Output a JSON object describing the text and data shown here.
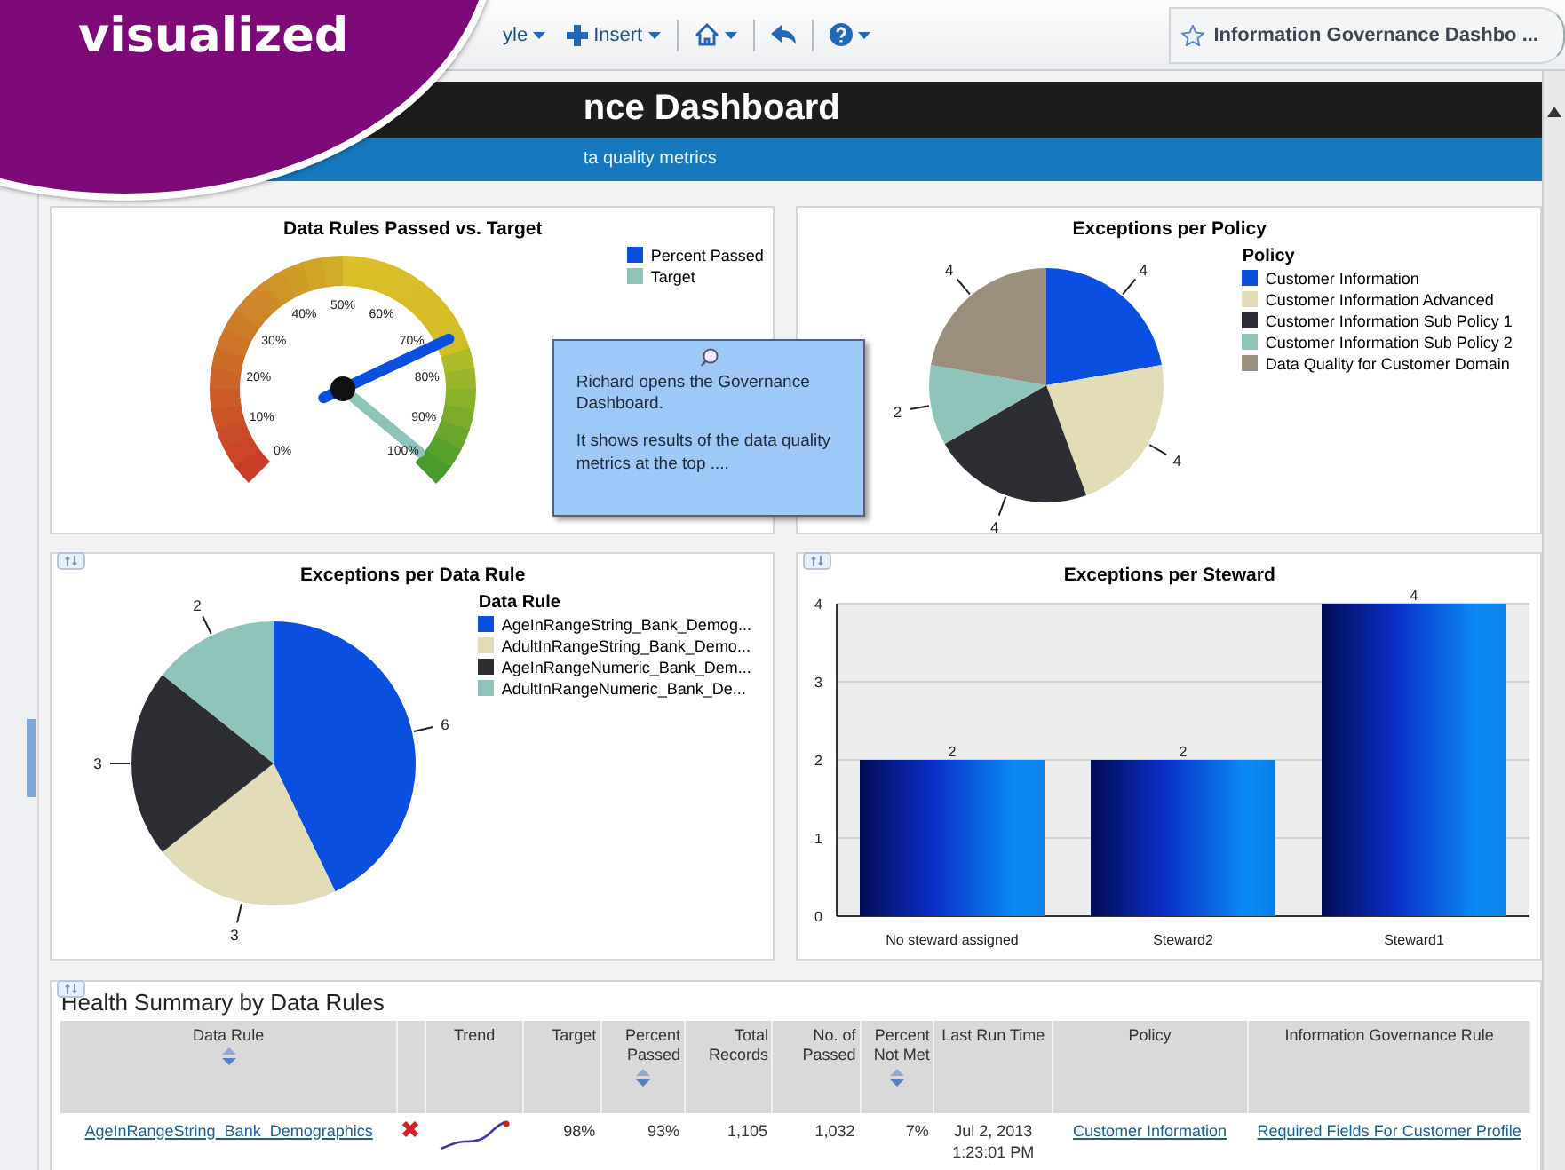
{
  "overlay_label": "visualized",
  "toolbar": {
    "items": [
      {
        "kind": "menu",
        "label": "yle"
      },
      {
        "kind": "insert",
        "label": "Insert"
      },
      {
        "kind": "home"
      },
      {
        "kind": "back"
      },
      {
        "kind": "help"
      }
    ],
    "tab_title": "Information Governance Dashbo ..."
  },
  "dashboard": {
    "title": "nce Dashboard",
    "subtitle": "ta quality metrics"
  },
  "gauge_panel": {
    "title": "Data Rules Passed vs. Target",
    "tick_labels": [
      "0%",
      "10%",
      "20%",
      "30%",
      "40%",
      "50%",
      "60%",
      "70%",
      "80%",
      "90%",
      "100%"
    ],
    "legend": [
      {
        "label": "Percent Passed",
        "color": "#0a4fe0"
      },
      {
        "label": "Target",
        "color": "#8fc4bb"
      }
    ]
  },
  "note": {
    "paragraphs": [
      "Richard opens the Governance Dashboard.",
      "It shows results of the data quality metrics at the top ...."
    ]
  },
  "policy_panel": {
    "chart_data": {
      "type": "pie",
      "title": "Exceptions per Policy",
      "categories": [
        "Customer Information",
        "Customer Information Advanced",
        "Customer Information Sub Policy 1",
        "Customer Information Sub Policy 2",
        "Data Quality for Customer Domain"
      ],
      "values": [
        4,
        4,
        4,
        2,
        4
      ],
      "colors": [
        "#0a4fe0",
        "#e2ddb6",
        "#2c2e33",
        "#8fc4bb",
        "#9a8e7c"
      ],
      "value_labels": [
        "4",
        "4",
        "4",
        "2",
        "4"
      ],
      "legend": {
        "title": "Policy"
      }
    }
  },
  "rule_panel": {
    "chart_data": {
      "type": "pie",
      "title": "Exceptions per Data Rule",
      "categories": [
        "AgeInRangeString_Bank_Demog...",
        "AdultInRangeString_Bank_Demo...",
        "AgeInRangeNumeric_Bank_Dem...",
        "AdultInRangeNumeric_Bank_De..."
      ],
      "values": [
        6,
        3,
        3,
        2
      ],
      "colors": [
        "#0a4fe0",
        "#e2ddb6",
        "#2c2e33",
        "#8fc4bb"
      ],
      "value_labels": [
        "6",
        "3",
        "3",
        "2"
      ],
      "legend": {
        "title": "Data Rule"
      }
    }
  },
  "steward_panel": {
    "chart_data": {
      "type": "bar",
      "title": "Exceptions per Steward",
      "categories": [
        "No steward assigned",
        "Steward2",
        "Steward1"
      ],
      "values": [
        2,
        2,
        4
      ],
      "ylim": [
        0,
        4
      ],
      "yticks": [
        0,
        1,
        2,
        3,
        4
      ],
      "grid": true,
      "data_labels": true
    }
  },
  "health_summary": {
    "title": "Health Summary by Data Rules",
    "columns": [
      {
        "label": "Data Rule",
        "sortable": true
      },
      {
        "sortable": false
      },
      {
        "label": "Trend",
        "sortable": false
      },
      {
        "label": "Target",
        "sortable": false
      },
      {
        "label": "Percent Passed",
        "sortable": true
      },
      {
        "label": "Total Records",
        "sortable": false
      },
      {
        "label": "No. of Passed",
        "sortable": false
      },
      {
        "label": "Percent Not Met",
        "sortable": true
      },
      {
        "label": "Last Run Time",
        "sortable": false
      },
      {
        "label": "Policy",
        "sortable": false
      },
      {
        "label": "Information Governance Rule",
        "sortable": false
      }
    ],
    "rows": [
      {
        "data_rule": "AgeInRangeString_Bank_Demographics",
        "failed": true,
        "target": "98%",
        "percent_passed": "93%",
        "total_records": "1,105",
        "no_of_passed": "1,032",
        "percent_not_met": "7%",
        "last_run_time": "Jul 2, 2013 1:23:01 PM",
        "policy": "Customer Information",
        "governance_rule": "Required Fields For Customer Profile"
      }
    ]
  }
}
